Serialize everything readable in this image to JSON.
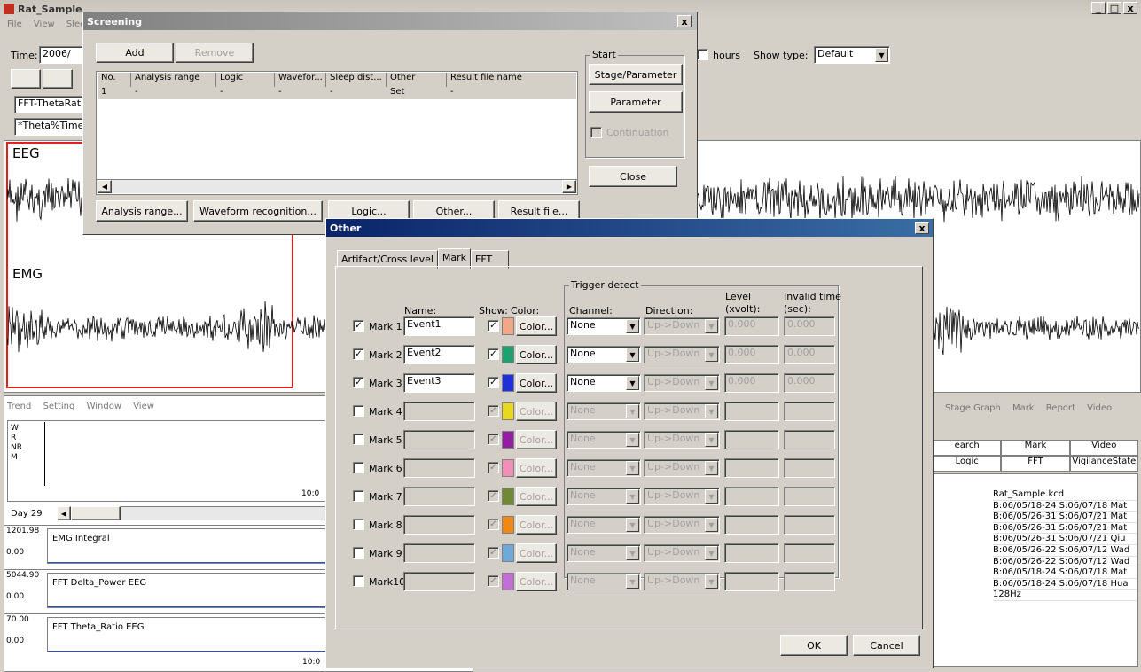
{
  "main": {
    "title": "Rat_Sample",
    "menu": [
      "File",
      "View",
      "Slee"
    ],
    "time_label": "Time:",
    "time_value": "2006/",
    "hours_label": "hours",
    "show_type_label": "Show type:",
    "show_type_value": "Default",
    "field1": "FFT-ThetaRat",
    "field2": "*Theta%Time",
    "eeg_label": "EEG",
    "emg_label": "EMG"
  },
  "lower_left": {
    "menu": [
      "Trend",
      "Setting",
      "Window",
      "View"
    ],
    "axis_labels": [
      "W",
      "R",
      "NR",
      "M"
    ],
    "time_tick": "10:0",
    "day_label": "Day 29",
    "rows": [
      {
        "top": "1201.98",
        "bottom": "0.00",
        "label": "EMG Integral"
      },
      {
        "top": "5044.90",
        "bottom": "0.00",
        "label": "FFT Delta_Power EEG"
      },
      {
        "top": "70.00",
        "bottom": "0.00",
        "label": "FFT Theta_Ratio EEG"
      }
    ],
    "bottom_tick": "10:0"
  },
  "lower_right": {
    "menu": [
      "Stage Graph",
      "Mark",
      "Report",
      "Video"
    ],
    "tabs_row1": [
      "earch",
      "Mark",
      "Video"
    ],
    "tabs_row2": [
      "Logic",
      "FFT",
      "VigilanceState"
    ],
    "rows": [
      "Rat_Sample.kcd",
      "B:06/05/18-24 S:06/07/18 Mat",
      "B:06/05/26-31 S:06/07/21 Mat",
      "B:06/05/26-31 S:06/07/21 Mat",
      "B:06/05/26-31 S:06/07/21 Qiu",
      "B:06/05/26-22 S:06/07/12 Wad",
      "B:06/05/26-22 S:06/07/12 Wad",
      "B:06/05/18-24 S:06/07/18 Mat",
      "B:06/05/18-24 S:06/07/18 Hua",
      "128Hz"
    ]
  },
  "screening": {
    "title": "Screening",
    "add": "Add",
    "remove": "Remove",
    "columns": [
      "No.",
      "Analysis range",
      "Logic",
      "Wavefor...",
      "Sleep dist...",
      "Other",
      "Result file name"
    ],
    "row": [
      "1",
      "-",
      "-",
      "-",
      "-",
      "Set",
      "-"
    ],
    "start_group": "Start",
    "stage_param": "Stage/Parameter",
    "parameter": "Parameter",
    "continuation": "Continuation",
    "close": "Close",
    "bottom_buttons": [
      "Analysis range...",
      "Waveform recognition...",
      "Logic...",
      "Other...",
      "Result file..."
    ]
  },
  "other": {
    "title": "Other",
    "tabs": [
      "Artifact/Cross level",
      "Mark",
      "FFT"
    ],
    "trigger_group": "Trigger detect",
    "headers": {
      "name": "Name:",
      "show": "Show:",
      "color": "Color:",
      "channel": "Channel:",
      "direction": "Direction:",
      "level": "Level",
      "level2": "(xvolt):",
      "invalid": "Invalid time",
      "invalid2": "(sec):"
    },
    "marks": [
      {
        "label": "Mark 1",
        "name": "Event1",
        "color": "#f0a888",
        "enabled": true,
        "channel": "None",
        "direction": "Up->Down",
        "level": "0.000",
        "invalid": "0.000"
      },
      {
        "label": "Mark 2",
        "name": "Event2",
        "color": "#20a070",
        "enabled": true,
        "channel": "None",
        "direction": "Up->Down",
        "level": "0.000",
        "invalid": "0.000"
      },
      {
        "label": "Mark 3",
        "name": "Event3",
        "color": "#2030d8",
        "enabled": true,
        "channel": "None",
        "direction": "Up->Down",
        "level": "0.000",
        "invalid": "0.000"
      },
      {
        "label": "Mark 4",
        "name": "",
        "color": "#e8d820",
        "enabled": false,
        "channel": "None",
        "direction": "Up->Down",
        "level": "",
        "invalid": ""
      },
      {
        "label": "Mark 5",
        "name": "",
        "color": "#9020a0",
        "enabled": false,
        "channel": "None",
        "direction": "Up->Down",
        "level": "",
        "invalid": ""
      },
      {
        "label": "Mark 6",
        "name": "",
        "color": "#f090b8",
        "enabled": false,
        "channel": "None",
        "direction": "Up->Down",
        "level": "",
        "invalid": ""
      },
      {
        "label": "Mark 7",
        "name": "",
        "color": "#708838",
        "enabled": false,
        "channel": "None",
        "direction": "Up->Down",
        "level": "",
        "invalid": ""
      },
      {
        "label": "Mark 8",
        "name": "",
        "color": "#f08818",
        "enabled": false,
        "channel": "None",
        "direction": "Up->Down",
        "level": "",
        "invalid": ""
      },
      {
        "label": "Mark 9",
        "name": "",
        "color": "#70a8d8",
        "enabled": false,
        "channel": "None",
        "direction": "Up->Down",
        "level": "",
        "invalid": ""
      },
      {
        "label": "Mark10",
        "name": "",
        "color": "#c070d0",
        "enabled": false,
        "channel": "None",
        "direction": "Up->Down",
        "level": "",
        "invalid": ""
      }
    ],
    "color_btn": "Color...",
    "ok": "OK",
    "cancel": "Cancel"
  }
}
